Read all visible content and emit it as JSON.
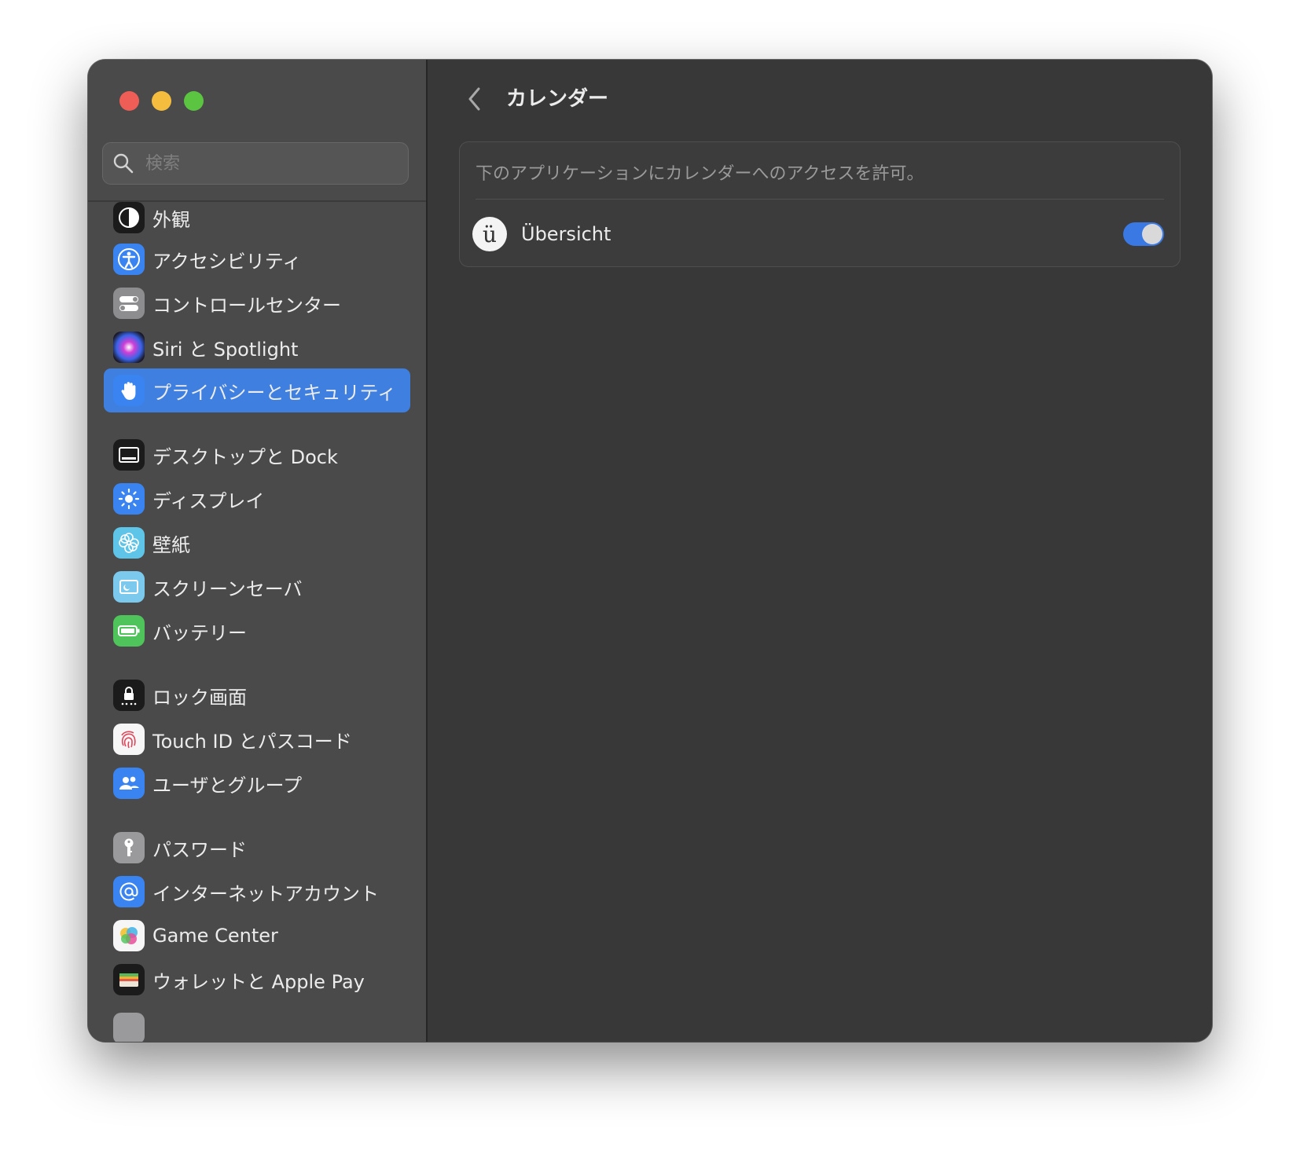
{
  "search": {
    "placeholder": "検索"
  },
  "sidebar": {
    "items": [
      {
        "label": "外観",
        "icon": "appearance-icon"
      },
      {
        "label": "アクセシビリティ",
        "icon": "accessibility-icon"
      },
      {
        "label": "コントロールセンター",
        "icon": "control-center-icon"
      },
      {
        "label": "Siri と Spotlight",
        "icon": "siri-icon"
      },
      {
        "label": "プライバシーとセキュリティ",
        "icon": "hand-icon",
        "selected": true
      },
      {
        "label": "デスクトップと Dock",
        "icon": "desktop-dock-icon"
      },
      {
        "label": "ディスプレイ",
        "icon": "display-icon"
      },
      {
        "label": "壁紙",
        "icon": "wallpaper-icon"
      },
      {
        "label": "スクリーンセーバ",
        "icon": "screensaver-icon"
      },
      {
        "label": "バッテリー",
        "icon": "battery-icon"
      },
      {
        "label": "ロック画面",
        "icon": "lock-screen-icon"
      },
      {
        "label": "Touch ID とパスコード",
        "icon": "fingerprint-icon"
      },
      {
        "label": "ユーザとグループ",
        "icon": "users-icon"
      },
      {
        "label": "パスワード",
        "icon": "key-icon"
      },
      {
        "label": "インターネットアカウント",
        "icon": "at-icon"
      },
      {
        "label": "Game Center",
        "icon": "game-center-icon"
      },
      {
        "label": "ウォレットと Apple Pay",
        "icon": "wallet-icon"
      }
    ]
  },
  "main": {
    "title": "カレンダー",
    "description": "下のアプリケーションにカレンダーへのアクセスを許可。",
    "apps": [
      {
        "name": "Übersicht",
        "icon_letter": "ü",
        "enabled": true
      }
    ]
  },
  "colors": {
    "accent": "#3f7fe0",
    "toggle_on": "#3a79e3",
    "sidebar_bg": "#4a4a4b",
    "content_bg": "#383838"
  }
}
